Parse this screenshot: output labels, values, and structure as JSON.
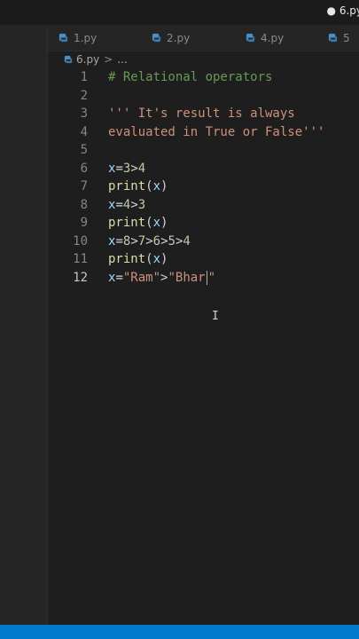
{
  "window": {
    "dirty_tab_label": "● 6.py"
  },
  "tabs": [
    {
      "label": "1.py"
    },
    {
      "label": "2.py"
    },
    {
      "label": "4.py"
    },
    {
      "label": "5"
    }
  ],
  "breadcrumb": {
    "file": "6.py",
    "separator": ">",
    "symbol": "..."
  },
  "editor": {
    "line_numbers": [
      "1",
      "2",
      "3",
      "4",
      "5",
      "6",
      "7",
      "8",
      "9",
      "10",
      "11",
      "12"
    ],
    "lines": {
      "l1": "# Relational operators",
      "l3": "''' It's result is always",
      "l4": "evaluated in True or False'''",
      "l6": {
        "var": "x",
        "eq": "=",
        "a": "3",
        "op": ">",
        "b": "4"
      },
      "l7": {
        "fn": "print",
        "open": "(",
        "arg": "x",
        "close": ")"
      },
      "l8": {
        "var": "x",
        "eq": "=",
        "a": "4",
        "op": ">",
        "b": "3"
      },
      "l9": {
        "fn": "print",
        "open": "(",
        "arg": "x",
        "close": ")"
      },
      "l10": {
        "var": "x",
        "eq": "=",
        "a": "8",
        "op1": ">",
        "b": "7",
        "op2": ">",
        "c": "6",
        "op3": ">",
        "d": "5",
        "op4": ">",
        "e": "4"
      },
      "l11": {
        "fn": "print",
        "open": "(",
        "arg": "x",
        "close": ")"
      },
      "l12": {
        "var": "x",
        "eq": "=",
        "s1": "\"Ram\"",
        "op": ">",
        "s2a": "\"Bhar",
        "s2b": "\""
      }
    },
    "active_line": "12"
  },
  "colors": {
    "background": "#1e1e1e",
    "comment": "#6a9955",
    "string": "#ce9178",
    "number": "#b5cea8",
    "function": "#dcdcaa",
    "variable": "#9cdcfe",
    "statusbar": "#007acc",
    "python_icon": "#4a8ec4"
  },
  "icons": {
    "tab_icon": "python-file-icon",
    "mouse": "text-cursor-icon"
  }
}
